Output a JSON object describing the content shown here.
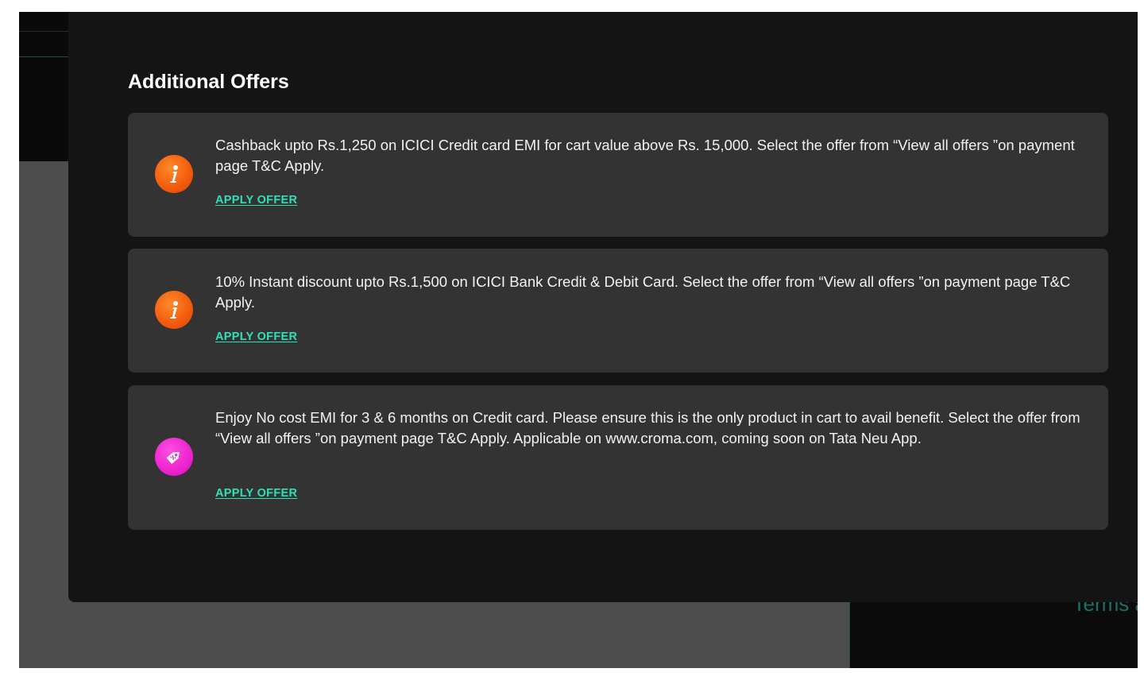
{
  "background": {
    "terms_text": "Terms a"
  },
  "modal": {
    "title": "Additional Offers",
    "offers": [
      {
        "icon": "info-icon",
        "text": "Cashback upto Rs.1,250 on ICICI Credit card EMI for cart value above Rs. 15,000. Select the offer from “View all offers ”on payment page T&C Apply.",
        "action_label": "APPLY OFFER"
      },
      {
        "icon": "info-icon",
        "text": "10% Instant discount upto Rs.1,500 on ICICI Bank Credit & Debit Card. Select the offer from “View all offers ”on payment page T&C Apply.",
        "action_label": "APPLY OFFER"
      },
      {
        "icon": "tag-icon",
        "text": "Enjoy No cost EMI for 3 & 6 months on Credit card. Please ensure this is the only product in cart to avail benefit. Select the offer from “View all offers ”on payment page T&C Apply. Applicable on www.croma.com, coming soon on Tata Neu App.",
        "action_label": "APPLY OFFER"
      }
    ]
  },
  "colors": {
    "modal_bg": "#141414",
    "card_bg": "#333333",
    "accent": "#2fe0b8",
    "info_icon": "#f25a0c",
    "tag_icon": "#e81ec8"
  }
}
